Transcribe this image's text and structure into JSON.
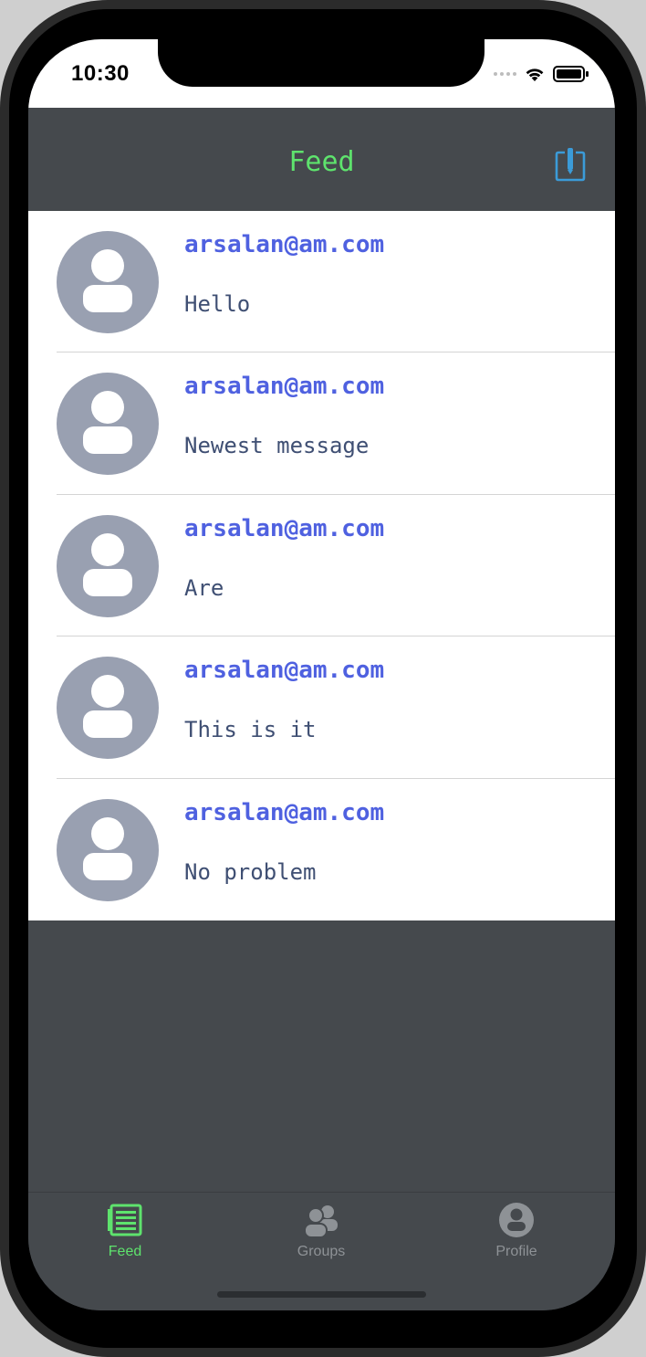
{
  "status_bar": {
    "time": "10:30"
  },
  "nav": {
    "title": "Feed",
    "title_color": "#5ee36d",
    "compose_icon": "compose-icon"
  },
  "feed": {
    "items": [
      {
        "email": "arsalan@am.com",
        "message": "Hello"
      },
      {
        "email": "arsalan@am.com",
        "message": "Newest message"
      },
      {
        "email": "arsalan@am.com",
        "message": "Are"
      },
      {
        "email": "arsalan@am.com",
        "message": "This is it"
      },
      {
        "email": "arsalan@am.com",
        "message": "No problem"
      }
    ]
  },
  "tabs": [
    {
      "label": "Feed",
      "icon": "feed-icon",
      "active": true,
      "color": "#5ee36d"
    },
    {
      "label": "Groups",
      "icon": "groups-icon",
      "active": false,
      "color": "#8e9296"
    },
    {
      "label": "Profile",
      "icon": "profile-icon",
      "active": false,
      "color": "#8e9296"
    }
  ],
  "colors": {
    "accent": "#5ee36d",
    "email": "#4f61e0",
    "message": "#3f4f73",
    "nav_background": "#45494d",
    "avatar": "#99a0b1"
  }
}
